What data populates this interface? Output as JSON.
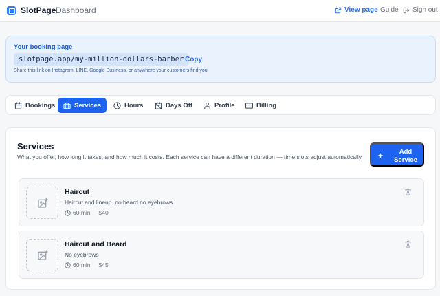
{
  "header": {
    "brand": "SlotPage",
    "breadcrumb": "Dashboard",
    "view_page": "View page",
    "guide": "Guide",
    "sign_out": "Sign out"
  },
  "booking": {
    "title": "Your booking page",
    "url": "slotpage.app/my-million-dollars-barber",
    "copy": "Copy",
    "note": "Share this link on Instagram, LINE, Google Business, or anywhere your customers find you."
  },
  "tabs": [
    {
      "label": "Bookings",
      "icon": "calendar-icon",
      "active": false
    },
    {
      "label": "Services",
      "icon": "briefcase-icon",
      "active": true
    },
    {
      "label": "Hours",
      "icon": "clock-icon",
      "active": false
    },
    {
      "label": "Days Off",
      "icon": "calendar-off-icon",
      "active": false
    },
    {
      "label": "Profile",
      "icon": "user-icon",
      "active": false
    },
    {
      "label": "Billing",
      "icon": "credit-card-icon",
      "active": false
    }
  ],
  "services_panel": {
    "title": "Services",
    "description": "What you offer, how long it takes, and how much it costs. Each service can have a different duration — time slots adjust automatically.",
    "add_button": "Add Service",
    "items": [
      {
        "name": "Haircut",
        "description": "Haircut and lineup. no beard no eyebrows",
        "duration": "60 min",
        "price": "$40"
      },
      {
        "name": "Haircut and Beard",
        "description": "No eyebrows",
        "duration": "60 min",
        "price": "$45"
      }
    ]
  },
  "colors": {
    "accent": "#1e63f0",
    "link": "#2f6fe8",
    "banner_bg": "#eaf2fd"
  }
}
